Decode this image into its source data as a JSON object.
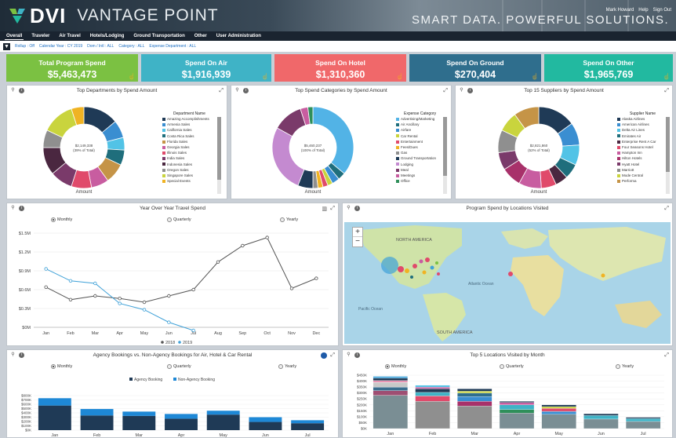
{
  "header": {
    "brand": "DVI",
    "product": "VANTAGE POINT",
    "tagline": "SMART DATA. POWERFUL SOLUTIONS.",
    "user_links": [
      "Mark Howard",
      "Help",
      "Sign Out"
    ]
  },
  "nav": {
    "tabs": [
      "Overall",
      "Traveler",
      "Air Travel",
      "Hotels/Lodging",
      "Ground Transportation",
      "Other",
      "User Administration"
    ],
    "active": "Overall"
  },
  "filters": [
    "Rollup : Off",
    "Calendar Year : CY 2019",
    "Dom / Intl : ALL",
    "Category : ALL",
    "Expense Department : ALL"
  ],
  "kpis": [
    {
      "label": "Total Program Spend",
      "value": "$5,463,473",
      "color": "#7bc142"
    },
    {
      "label": "Spend On Air",
      "value": "$1,916,939",
      "color": "#3fb3c6"
    },
    {
      "label": "Spend On Hotel",
      "value": "$1,310,360",
      "color": "#f0686a"
    },
    {
      "label": "Spend On Ground",
      "value": "$270,404",
      "color": "#2f6e8d"
    },
    {
      "label": "Spend On Other",
      "value": "$1,965,769",
      "color": "#22b9a0"
    }
  ],
  "donut1": {
    "title": "Top Departments by Spend Amount",
    "center_value": "$2,149,338",
    "center_sub": "(39% of Total)",
    "axis_label": "Amount",
    "legend_title": "Department Name",
    "legend": [
      "Amazing Accomplishments",
      "Armenia Sales",
      "California Sales",
      "Costa Rica Sales",
      "Florida Sales",
      "Georgia Sales",
      "Illinois Sales",
      "India Sales",
      "Indonesia Sales",
      "Oregon Sales",
      "Singapore Sales",
      "Special Events"
    ]
  },
  "donut2": {
    "title": "Top Spend Categories by Spend Amount",
    "center_value": "$5,460,237",
    "center_sub": "(100% of Total)",
    "axis_label": "Amount",
    "legend_title": "Expense Category",
    "legend": [
      "Advertising/Marketing",
      "Air Ancillary",
      "Airfare",
      "Car Rental",
      "Entertainment",
      "Fees/Dues",
      "Gas",
      "Ground Transportation",
      "Lodging",
      "Meal",
      "Meetings",
      "Office"
    ]
  },
  "donut3": {
    "title": "Top 15 Suppliers by Spend Amount",
    "center_value": "$2,821,860",
    "center_sub": "(52% of Total)",
    "axis_label": "Amount",
    "legend_title": "Supplier Name",
    "legend": [
      "Alaska Airlines",
      "American Airlines",
      "Delta Air Lines",
      "Emirates Air",
      "Enterprise Rent A Car",
      "Four Seasons Hotel",
      "Hampton Inn",
      "Hilton Hotels",
      "Hyatt Hotel",
      "Marriott",
      "Mode Central",
      "Performa"
    ]
  },
  "yoy": {
    "title": "Year Over Year Travel Spend",
    "radios": [
      "Monthly",
      "Quarterly",
      "Yearly"
    ],
    "selected": "Monthly",
    "legend": [
      "2018",
      "2019"
    ]
  },
  "map": {
    "title": "Program Spend by Locations Visited",
    "zoom_in": "+",
    "zoom_out": "−",
    "labels": [
      "NORTH AMERICA",
      "SOUTH AMERICA",
      "Pacific Ocean",
      "Atlantic Ocean"
    ]
  },
  "agency": {
    "title": "Agency Bookings vs. Non-Agency Bookings for Air, Hotel & Car Rental",
    "radios": [
      "Monthly",
      "Quarterly",
      "Yearly"
    ],
    "selected": "Monthly",
    "legend": [
      "Agency Booking",
      "Non-Agency Booking"
    ]
  },
  "top5": {
    "title": "Top 5 Locations Visited by Month",
    "radios": [
      "Monthly",
      "Quarterly",
      "Yearly"
    ],
    "selected": "Monthly"
  },
  "chart_data": [
    {
      "type": "pie",
      "title": "Top Departments by Spend Amount",
      "categories": [
        "Amazing Accomplishments",
        "Armenia Sales",
        "California Sales",
        "Costa Rica Sales",
        "Florida Sales",
        "Georgia Sales",
        "Illinois Sales",
        "India Sales",
        "Indonesia Sales",
        "Oregon Sales",
        "Singapore Sales",
        "Special Events"
      ],
      "values": [
        14,
        7,
        5,
        6,
        8,
        7,
        8,
        9,
        11,
        7,
        13,
        5
      ],
      "colors": [
        "#1f3a56",
        "#3a8ed1",
        "#52c3e6",
        "#1f6e7c",
        "#c59447",
        "#c85da0",
        "#e04a6b",
        "#7a3a6a",
        "#4a2740",
        "#8f8f8f",
        "#c9d43d",
        "#f0b323"
      ]
    },
    {
      "type": "pie",
      "title": "Top Spend Categories by Spend Amount",
      "categories": [
        "Advertising/Marketing",
        "Air Ancillary",
        "Airfare",
        "Car Rental",
        "Entertainment",
        "Fees/Dues",
        "Gas",
        "Ground Transportation",
        "Lodging",
        "Meal",
        "Meetings",
        "Office"
      ],
      "values": [
        36,
        3,
        3,
        2,
        2,
        2,
        2,
        6,
        27,
        12,
        3,
        2
      ],
      "colors": [
        "#52b3e6",
        "#1f6e7c",
        "#3a8ed1",
        "#c9d43d",
        "#e04a6b",
        "#f0b323",
        "#8f8f8f",
        "#1f3a56",
        "#c48ad0",
        "#7a3a6a",
        "#c85da0",
        "#2f8f5a"
      ]
    },
    {
      "type": "pie",
      "title": "Top 15 Suppliers by Spend Amount",
      "categories": [
        "Alaska Airlines",
        "American Airlines",
        "Delta Air Lines",
        "Emirates Air",
        "Enterprise Rent A Car",
        "Four Seasons Hotel",
        "Hampton Inn",
        "Hilton Hotels",
        "Hyatt Hotel",
        "Marriott",
        "Mode Central",
        "Performa"
      ],
      "values": [
        15,
        9,
        8,
        6,
        5,
        6,
        9,
        8,
        7,
        9,
        8,
        10
      ],
      "colors": [
        "#1f3a56",
        "#3a8ed1",
        "#52c3e6",
        "#1f6e7c",
        "#4a2740",
        "#e04a6b",
        "#c85da0",
        "#a8316a",
        "#7a3a6a",
        "#8f8f8f",
        "#c9d43d",
        "#c59447"
      ]
    },
    {
      "type": "line",
      "title": "Year Over Year Travel Spend",
      "categories": [
        "Jan",
        "Feb",
        "Mar",
        "Apr",
        "May",
        "Jun",
        "Jul",
        "Aug",
        "Sep",
        "Oct",
        "Nov",
        "Dec"
      ],
      "yticks": [
        "$0M",
        "$0.3M",
        "$0.6M",
        "$0.9M",
        "$1.2M",
        "$1.5M"
      ],
      "ylim": [
        0,
        1.5
      ],
      "series": [
        {
          "name": "2018",
          "color": "#555555",
          "values": [
            0.64,
            0.44,
            0.5,
            0.46,
            0.4,
            0.5,
            0.6,
            1.04,
            1.3,
            1.43,
            0.62,
            0.78
          ]
        },
        {
          "name": "2019",
          "color": "#3fa1d8",
          "values": [
            0.93,
            0.74,
            0.7,
            0.38,
            0.28,
            0.08,
            -0.05,
            null,
            null,
            null,
            null,
            null
          ]
        }
      ]
    },
    {
      "type": "bar",
      "title": "Agency Bookings vs. Non-Agency Bookings for Air, Hotel & Car Rental",
      "categories": [
        "Jan",
        "Feb",
        "Mar",
        "Apr",
        "May",
        "Jun",
        "Jul"
      ],
      "yticks": [
        "$0K",
        "$100K",
        "$200K",
        "$300K",
        "$400K",
        "$500K",
        "$600K",
        "$700K",
        "$800K"
      ],
      "ylim": [
        0,
        800
      ],
      "series": [
        {
          "name": "Agency Booking",
          "color": "#1f3a56",
          "values": [
            570,
            340,
            330,
            265,
            360,
            190,
            160
          ]
        },
        {
          "name": "Non-Agency Booking",
          "color": "#1e88d6",
          "values": [
            170,
            150,
            100,
            110,
            90,
            110,
            70
          ]
        }
      ]
    },
    {
      "type": "bar",
      "title": "Top 5 Locations Visited by Month",
      "categories": [
        "Jan",
        "Feb",
        "Mar",
        "Apr",
        "May",
        "Jun",
        "Jul"
      ],
      "yticks": [
        "$0K",
        "$50K",
        "$100K",
        "$150K",
        "$200K",
        "$250K",
        "$300K",
        "$350K",
        "$400K",
        "$450K"
      ],
      "ylim": [
        0,
        450
      ],
      "stacks": [
        [
          {
            "c": "#7a8e94",
            "v": 280
          },
          {
            "c": "#9e4e72",
            "v": 40
          },
          {
            "c": "#3a6d8e",
            "v": 30
          },
          {
            "c": "#c8c8c8",
            "v": 40
          },
          {
            "c": "#e88fb0",
            "v": 15
          },
          {
            "c": "#1f3a56",
            "v": 20
          },
          {
            "c": "#3fa1d8",
            "v": 15
          }
        ],
        [
          {
            "c": "#8f8f8f",
            "v": 230
          },
          {
            "c": "#e04a6b",
            "v": 45
          },
          {
            "c": "#3fb3c6",
            "v": 30
          },
          {
            "c": "#1f3a56",
            "v": 30
          },
          {
            "c": "#c85da0",
            "v": 15
          },
          {
            "c": "#52c3e6",
            "v": 15
          }
        ],
        [
          {
            "c": "#8f8f8f",
            "v": 190
          },
          {
            "c": "#a8316a",
            "v": 40
          },
          {
            "c": "#3a8ed1",
            "v": 40
          },
          {
            "c": "#2f6e8d",
            "v": 30
          },
          {
            "c": "#c9d43d",
            "v": 15
          },
          {
            "c": "#1f3a56",
            "v": 20
          }
        ],
        [
          {
            "c": "#7a8e94",
            "v": 130
          },
          {
            "c": "#2f8f5a",
            "v": 30
          },
          {
            "c": "#3fb3c6",
            "v": 40
          },
          {
            "c": "#c85da0",
            "v": 20
          },
          {
            "c": "#1f3a56",
            "v": 10
          }
        ],
        [
          {
            "c": "#7a8e94",
            "v": 120
          },
          {
            "c": "#3a8ed1",
            "v": 25
          },
          {
            "c": "#e04a6b",
            "v": 25
          },
          {
            "c": "#c9d43d",
            "v": 15
          },
          {
            "c": "#1f3a56",
            "v": 15
          }
        ],
        [
          {
            "c": "#7a8e94",
            "v": 80
          },
          {
            "c": "#3fb3c6",
            "v": 30
          },
          {
            "c": "#1f3a56",
            "v": 15
          }
        ],
        [
          {
            "c": "#7a8e94",
            "v": 60
          },
          {
            "c": "#3fb3c6",
            "v": 25
          },
          {
            "c": "#1f3a56",
            "v": 10
          }
        ]
      ]
    }
  ]
}
